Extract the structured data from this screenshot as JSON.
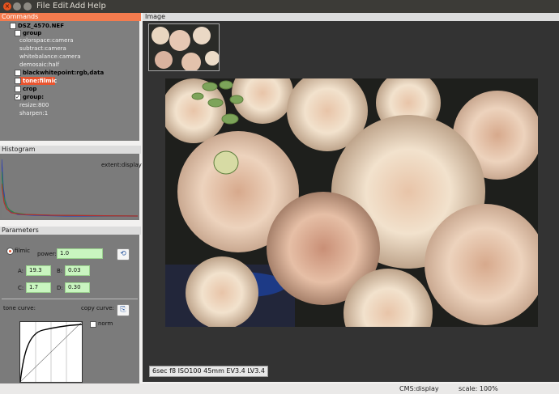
{
  "window": {
    "menu": [
      "File",
      "Edit",
      "Add",
      "Help"
    ]
  },
  "commands": {
    "title": "Commands",
    "file": "DSZ_4570.NEF",
    "group1": "group",
    "group1_items": [
      "colorspace:camera",
      "subtract:camera",
      "whitebalance:camera",
      "demosaic:half"
    ],
    "blackwhitepoint": "blackwhitepoint:rgb,data",
    "tone": "tone:filmic",
    "crop": "crop",
    "group2": "group:",
    "group2_items": [
      "resize:800",
      "sharpen:1"
    ]
  },
  "histogram": {
    "title": "Histogram",
    "extent": "extent:display"
  },
  "parameters": {
    "title": "Parameters",
    "filmic_label": "filmic",
    "power_label": "power:",
    "power_value": "1.0",
    "A_label": "A:",
    "A_value": "19.3",
    "B_label": "B:",
    "B_value": "0.03",
    "C_label": "C:",
    "C_value": "1.7",
    "D_label": "D:",
    "D_value": "0.30",
    "tone_curve_label": "tone curve:",
    "copy_curve_label": "copy curve:",
    "norm_label": "norm"
  },
  "image": {
    "title": "Image",
    "exif": "6sec  f8  ISO100  45mm  EV3.4 LV3.4"
  },
  "status": {
    "cms": "CMS:display",
    "scale": "scale: 100%"
  }
}
